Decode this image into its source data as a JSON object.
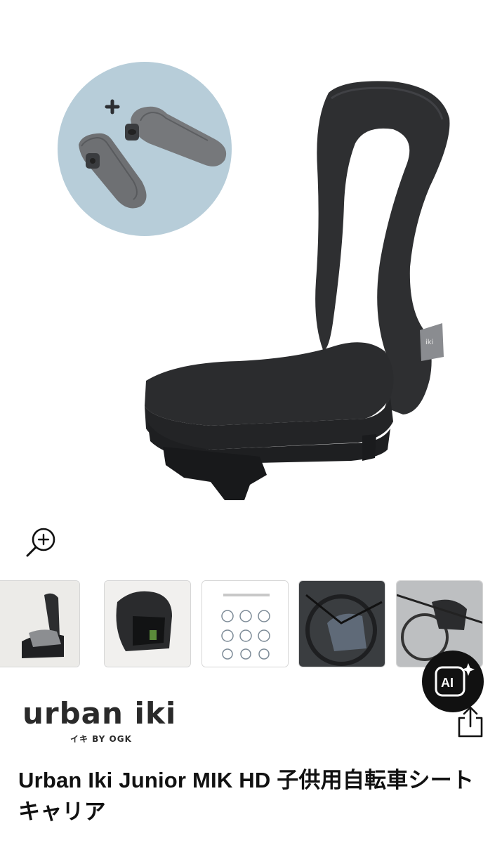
{
  "product": {
    "title": "Urban Iki Junior MIK HD 子供用自転車シートキャリア"
  },
  "brand": {
    "name": "urban iki",
    "tagline": "イキ BY OGK"
  },
  "gallery": {
    "thumbnail_count": 5,
    "zoom_icon": "zoom-in-icon"
  },
  "floating_actions": {
    "ai_label": "AI",
    "ai_icon": "ai-sparkle-icon",
    "share_icon": "share-icon"
  },
  "colors": {
    "seat": "#2c2d2f",
    "inset_bg": "#b7cdd9",
    "footrest": "#6b6d70",
    "ai_button_bg": "#111111"
  }
}
